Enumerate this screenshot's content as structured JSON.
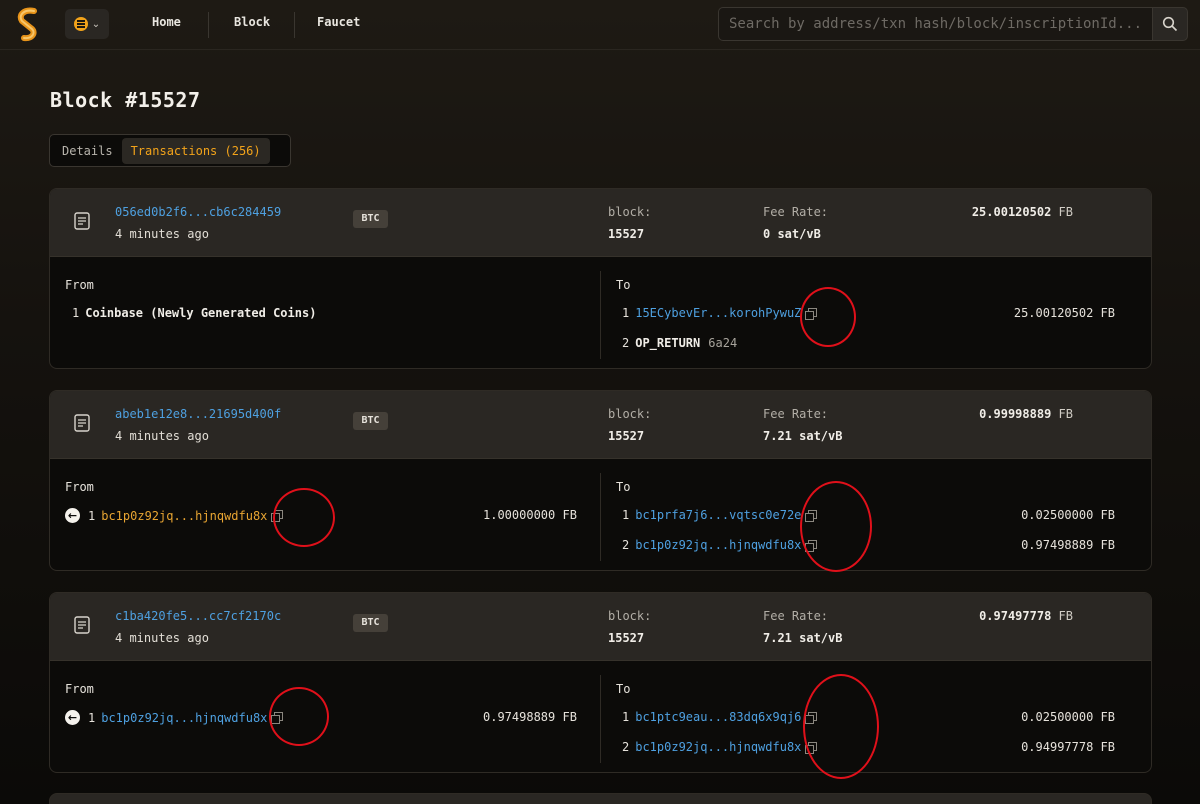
{
  "nav": {
    "items": [
      "Home",
      "Block",
      "Faucet"
    ],
    "search_placeholder": "Search by address/txn hash/block/inscriptionId..."
  },
  "page": {
    "title": "Block #15527",
    "tabs": [
      "Details",
      "Transactions (256)"
    ],
    "active_tab": "Transactions (256)"
  },
  "labels": {
    "block": "block:",
    "fee_rate": "Fee Rate:",
    "from": "From",
    "to": "To",
    "unit": "FB"
  },
  "transactions": [
    {
      "hash": "056ed0b2f6...cb6c284459",
      "time": "4 minutes ago",
      "chain": "BTC",
      "block": "15527",
      "fee_rate": "0 sat/vB",
      "amount": "25.00120502",
      "inputs": [
        {
          "idx": "1",
          "text": "Coinbase (Newly Generated Coins)"
        }
      ],
      "outputs": [
        {
          "idx": "1",
          "addr": "15ECybevEr...korohPywuZ",
          "amount": "25.00120502 FB"
        },
        {
          "idx": "2",
          "label": "OP_RETURN",
          "extra": "6a24"
        }
      ]
    },
    {
      "hash": "abeb1e12e8...21695d400f",
      "time": "4 minutes ago",
      "chain": "BTC",
      "block": "15527",
      "fee_rate": "7.21 sat/vB",
      "amount": "0.99998889",
      "inputs": [
        {
          "idx": "1",
          "addr": "bc1p0z92jq...hjnqwdfu8x",
          "amount": "1.00000000 FB"
        }
      ],
      "outputs": [
        {
          "idx": "1",
          "addr": "bc1prfa7j6...vqtsc0e72e",
          "amount": "0.02500000 FB"
        },
        {
          "idx": "2",
          "addr": "bc1p0z92jq...hjnqwdfu8x",
          "amount": "0.97498889 FB"
        }
      ]
    },
    {
      "hash": "c1ba420fe5...cc7cf2170c",
      "time": "4 minutes ago",
      "chain": "BTC",
      "block": "15527",
      "fee_rate": "7.21 sat/vB",
      "amount": "0.97497778",
      "inputs": [
        {
          "idx": "1",
          "addr": "bc1p0z92jq...hjnqwdfu8x",
          "amount": "0.97498889 FB"
        }
      ],
      "outputs": [
        {
          "idx": "1",
          "addr": "bc1ptc9eau...83dq6x9qj6",
          "amount": "0.02500000 FB"
        },
        {
          "idx": "2",
          "addr": "bc1p0z92jq...hjnqwdfu8x",
          "amount": "0.94997778 FB"
        }
      ]
    }
  ],
  "colors": {
    "accent": "#f2a31a",
    "link": "#4ea0e0",
    "annotation": "#e0101a"
  }
}
